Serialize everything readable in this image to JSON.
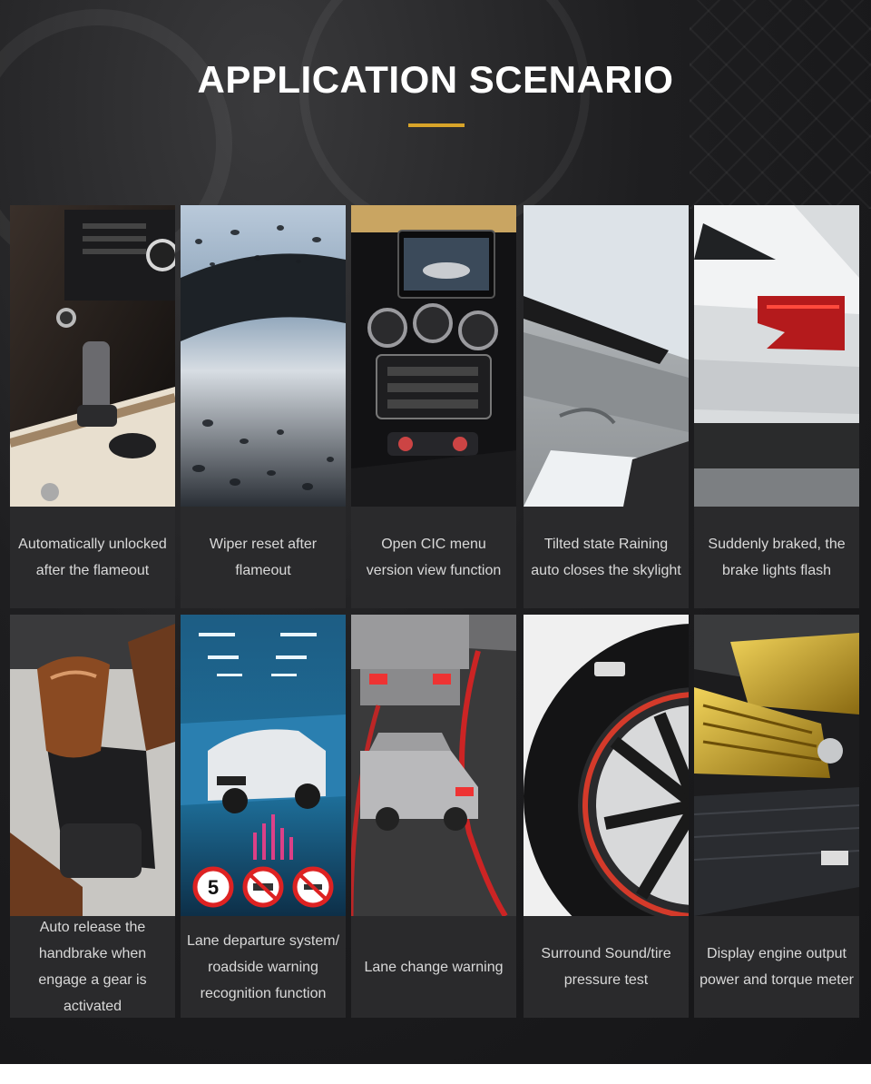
{
  "header": {
    "title": "APPLICATION SCENARIO",
    "accent_color": "#d8a429"
  },
  "cards": [
    {
      "image": "car-interior-gear-shifter",
      "caption": "Automatically unlocked after the flameout"
    },
    {
      "image": "raindrops-on-windshield",
      "caption": "Wiper reset after flameout"
    },
    {
      "image": "dashboard-screen-console",
      "caption": "Open CIC menu version view function"
    },
    {
      "image": "tilted-sunroof",
      "caption": "Tilted state Raining auto closes the skylight"
    },
    {
      "image": "rear-brake-light",
      "caption": "Suddenly braked, the brake lights flash"
    },
    {
      "image": "wood-gear-knob",
      "caption": "Auto release the handbrake when engage a gear is activated"
    },
    {
      "image": "car-in-tunnel-road-signs",
      "caption": "Lane departure system/ roadside warning recognition function"
    },
    {
      "image": "truck-and-car-lane",
      "caption": "Lane change warning"
    },
    {
      "image": "tire-close-up",
      "caption": "Surround Sound/tire pressure test"
    },
    {
      "image": "gold-engine-bay",
      "caption": "Display engine output power and torque meter"
    }
  ],
  "road_signs": [
    "5"
  ]
}
